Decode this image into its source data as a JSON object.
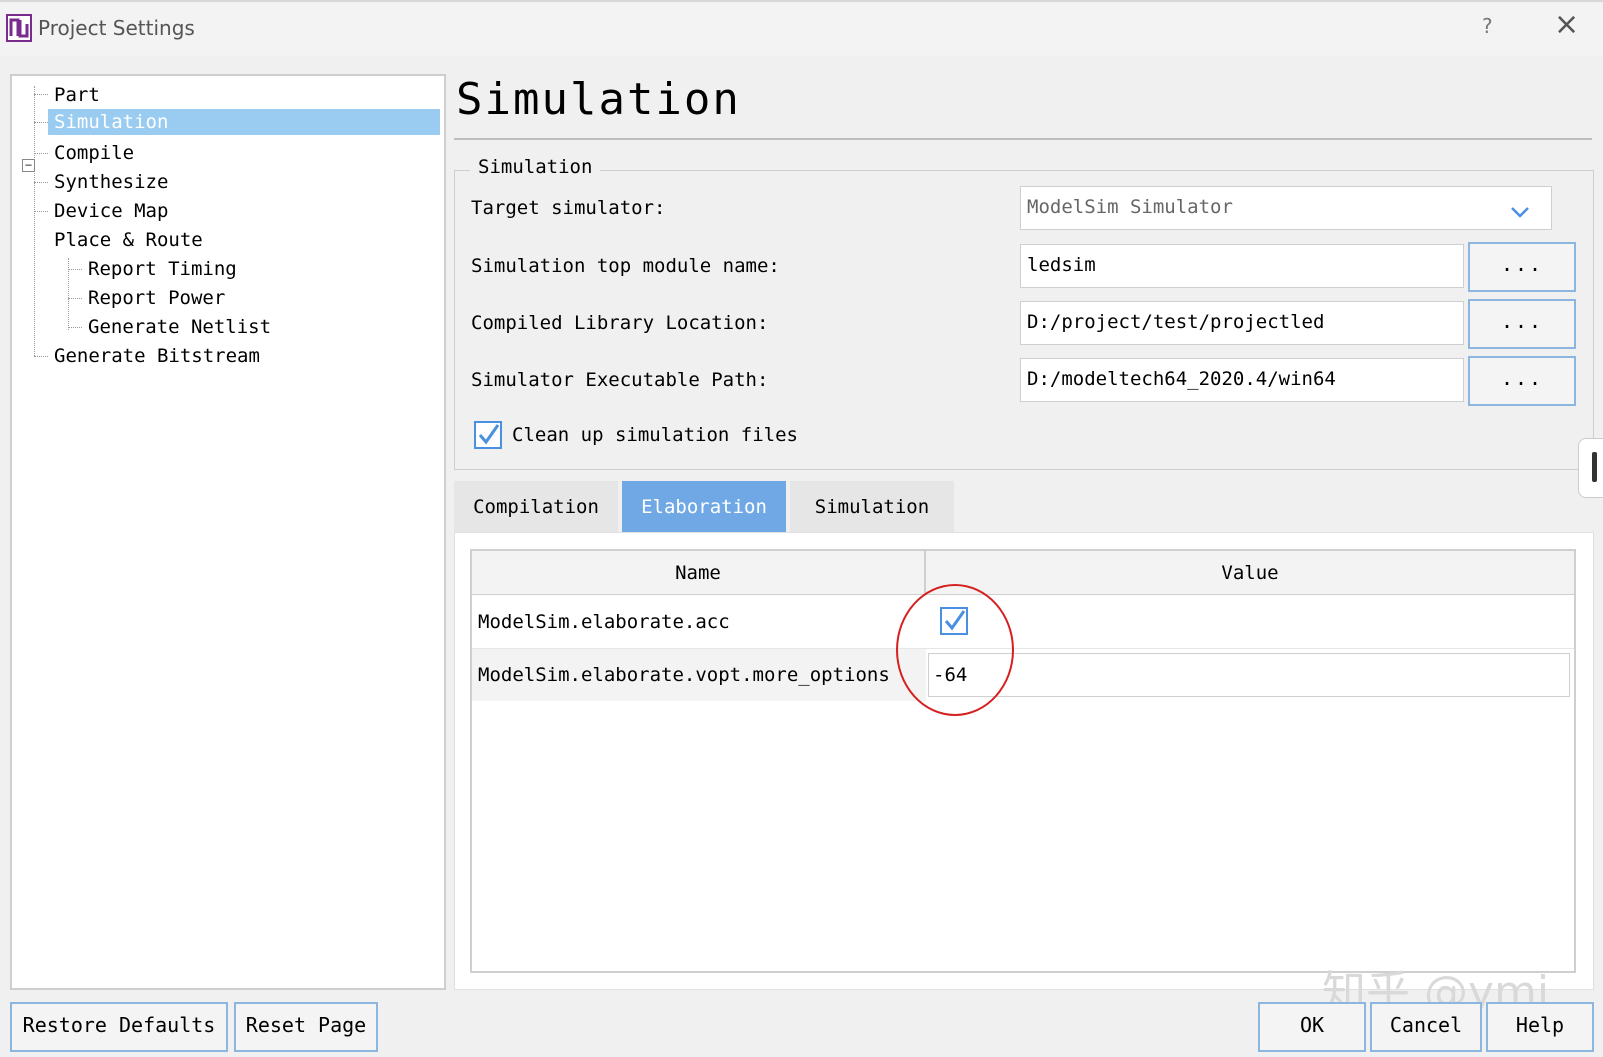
{
  "window": {
    "title": "Project Settings",
    "help": "?",
    "close": "×"
  },
  "tree": {
    "items": [
      {
        "label": "Part",
        "level": 0
      },
      {
        "label": "Simulation",
        "level": 0,
        "selected": true
      },
      {
        "label": "Compile",
        "level": 0
      },
      {
        "label": "Synthesize",
        "level": 0
      },
      {
        "label": "Device Map",
        "level": 0
      },
      {
        "label": "Place & Route",
        "level": 0,
        "expanded": true
      },
      {
        "label": "Report Timing",
        "level": 1
      },
      {
        "label": "Report Power",
        "level": 1
      },
      {
        "label": "Generate Netlist",
        "level": 1
      },
      {
        "label": "Generate Bitstream",
        "level": 0
      }
    ],
    "toggle_symbol": "−"
  },
  "page": {
    "heading": "Simulation"
  },
  "simulation_group": {
    "legend": "Simulation",
    "target_simulator": {
      "label": "Target simulator:",
      "value": "ModelSim Simulator"
    },
    "top_module": {
      "label": "Simulation top module name:",
      "value": "ledsim"
    },
    "library_location": {
      "label": "Compiled Library Location:",
      "value": "D:/project/test/projectled"
    },
    "executable_path": {
      "label": "Simulator Executable Path:",
      "value": "D:/modeltech64_2020.4/win64"
    },
    "browse_label": "...",
    "cleanup": {
      "label": "Clean up simulation files",
      "checked": true
    }
  },
  "tabs": [
    {
      "label": "Compilation",
      "active": false
    },
    {
      "label": "Elaboration",
      "active": true
    },
    {
      "label": "Simulation",
      "active": false
    }
  ],
  "properties": {
    "headers": {
      "name": "Name",
      "value": "Value"
    },
    "rows": [
      {
        "name": "ModelSim.elaborate.acc",
        "checked": true
      },
      {
        "name": "ModelSim.elaborate.vopt.more_options",
        "value": "-64"
      }
    ]
  },
  "buttons": {
    "restore_defaults": "Restore Defaults",
    "reset_page": "Reset Page",
    "ok": "OK",
    "cancel": "Cancel",
    "help": "Help"
  },
  "watermark": "知乎 @ymj",
  "colors": {
    "selection": "#99ccf0",
    "active_tab": "#6fa8e4",
    "checkbox": "#4a90e2",
    "annotation_circle": "#d62020"
  }
}
